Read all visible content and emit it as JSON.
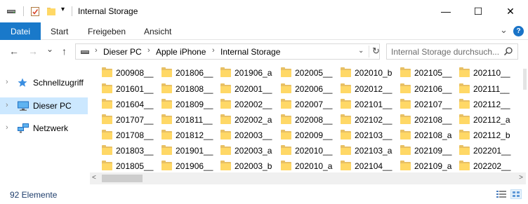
{
  "window": {
    "title": "Internal Storage",
    "minimize_glyph": "—",
    "maximize_glyph": "☐",
    "close_glyph": "✕",
    "qa_dropdown_glyph": "▾"
  },
  "ribbon": {
    "file_tab": "Datei",
    "tabs": [
      "Start",
      "Freigeben",
      "Ansicht"
    ],
    "expand_glyph": "⌄",
    "help_glyph": "?"
  },
  "nav": {
    "back_glyph": "←",
    "forward_glyph": "→",
    "recent_glyph": "⌄",
    "up_glyph": "↑",
    "breadcrumb": [
      "Dieser PC",
      "Apple iPhone",
      "Internal Storage"
    ],
    "crumb_separator": "›",
    "dropdown_glyph": "⌄",
    "refresh_glyph": "↻"
  },
  "search": {
    "placeholder": "Internal Storage durchsuch..."
  },
  "navpane": {
    "items": [
      {
        "label": "Schnellzugriff",
        "icon": "star-icon",
        "expand_glyph": "›"
      },
      {
        "label": "Dieser PC",
        "icon": "computer-icon",
        "expand_glyph": "›"
      },
      {
        "label": "Netzwerk",
        "icon": "network-icon",
        "expand_glyph": "›"
      }
    ]
  },
  "files": {
    "columns": [
      [
        "200908__",
        "201601__",
        "201604__",
        "201707__",
        "201708__",
        "201803__",
        "201805__"
      ],
      [
        "201806__",
        "201808__",
        "201809__",
        "201811__",
        "201812__",
        "201901__",
        "201906__"
      ],
      [
        "201906_a",
        "202001__",
        "202002__",
        "202002_a",
        "202003__",
        "202003_a",
        "202003_b"
      ],
      [
        "202005__",
        "202006__",
        "202007__",
        "202008__",
        "202009__",
        "202010__",
        "202010_a"
      ],
      [
        "202010_b",
        "202012__",
        "202101__",
        "202102__",
        "202103__",
        "202103_a",
        "202104__"
      ],
      [
        "202105__",
        "202106__",
        "202107__",
        "202108__",
        "202108_a",
        "202109__",
        "202109_a"
      ],
      [
        "202110__",
        "202111__",
        "202112__",
        "202112_a",
        "202112_b",
        "202201__",
        "202202__"
      ]
    ]
  },
  "hscroll": {
    "left_glyph": "<",
    "right_glyph": ">"
  },
  "status": {
    "item_count": "92 Elemente"
  },
  "colors": {
    "accent": "#1979ca",
    "selection": "#cce8ff",
    "folder_front": "#ffd866",
    "folder_back": "#e8c064"
  }
}
